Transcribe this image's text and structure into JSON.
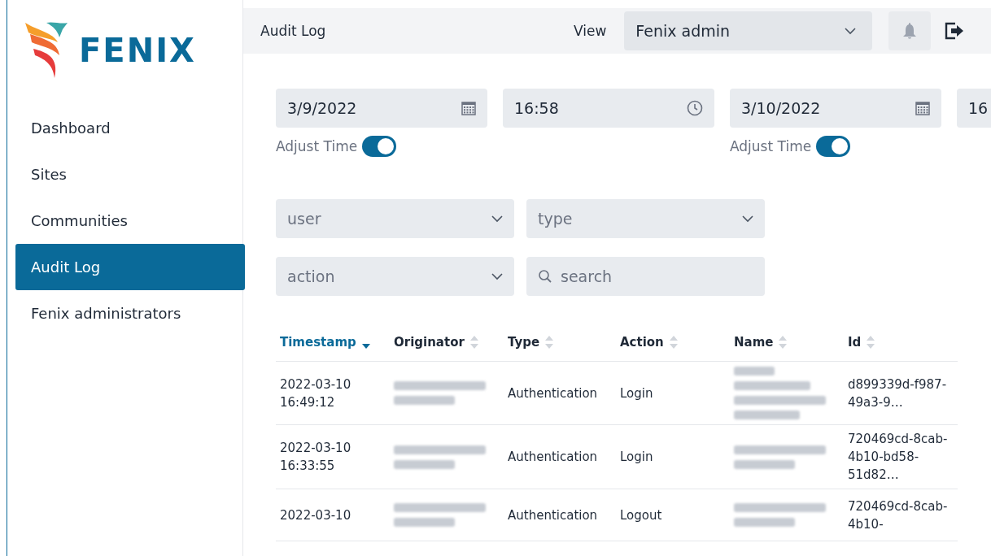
{
  "logo": {
    "text": "FENIX"
  },
  "sidebar": {
    "items": [
      {
        "label": "Dashboard",
        "selected": false
      },
      {
        "label": "Sites",
        "selected": false
      },
      {
        "label": "Communities",
        "selected": false
      },
      {
        "label": "Audit Log",
        "selected": true
      },
      {
        "label": "Fenix administrators",
        "selected": false
      }
    ]
  },
  "header": {
    "title": "Audit Log",
    "view_label": "View",
    "view_value": "Fenix admin"
  },
  "date_filters": [
    {
      "kind": "date",
      "value": "3/9/2022",
      "adjust_label": "Adjust Time",
      "adjust_on": true
    },
    {
      "kind": "time",
      "value": "16:58"
    },
    {
      "kind": "date",
      "value": "3/10/2022",
      "adjust_label": "Adjust Time",
      "adjust_on": true
    },
    {
      "kind": "cut_off",
      "value": "16"
    }
  ],
  "filters": [
    {
      "kind": "select",
      "placeholder": "user"
    },
    {
      "kind": "select",
      "placeholder": "type"
    },
    {
      "kind": "select",
      "placeholder": "action"
    },
    {
      "kind": "search",
      "placeholder": "search"
    }
  ],
  "table": {
    "columns": [
      {
        "label": "Timestamp",
        "sorted": true
      },
      {
        "label": "Originator",
        "sorted": false
      },
      {
        "label": "Type",
        "sorted": false
      },
      {
        "label": "Action",
        "sorted": false
      },
      {
        "label": "Name",
        "sorted": false
      },
      {
        "label": "Id",
        "sorted": false
      }
    ],
    "rows": [
      {
        "timestamp": "2022-03-10 16:49:12",
        "originator": {
          "kind": "blurred"
        },
        "type": "Authentication",
        "action": "Login",
        "name": {
          "kind": "blurred_tall"
        },
        "id": "d899339d-f987-49a3-9…"
      },
      {
        "timestamp": "2022-03-10 16:33:55",
        "originator": {
          "kind": "blurred"
        },
        "type": "Authentication",
        "action": "Login",
        "name": {
          "kind": "blurred"
        },
        "id": "720469cd-8cab-4b10-bd58-51d82…"
      },
      {
        "timestamp": "2022-03-10",
        "originator": {
          "kind": "blurred"
        },
        "type": "Authentication",
        "action": "Logout",
        "name": {
          "kind": "blurred"
        },
        "id": "720469cd-8cab-4b10-"
      }
    ]
  }
}
